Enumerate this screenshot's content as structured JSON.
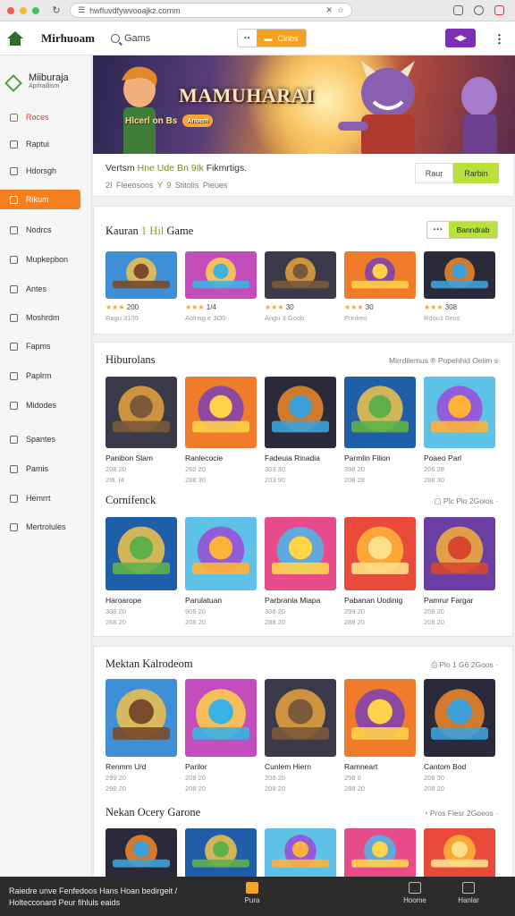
{
  "browser": {
    "url": "hwfluvdfywvooajkz.comm",
    "window_dots": [
      "#f25c54",
      "#f5bd3b",
      "#48c35a"
    ]
  },
  "header": {
    "brand": "Mirhuoam",
    "search_label": "Gams",
    "center_play_label": "Cinbs",
    "promo_label": "◀▶",
    "more_glyph": "··",
    "kebab_glyph": "⋮"
  },
  "sidebar": {
    "brand_name": "Miiburaja",
    "brand_sub": "Aprlraillism",
    "items": [
      {
        "label": "Roces",
        "state": "highlight"
      },
      {
        "label": "Raptui",
        "state": "normal"
      },
      {
        "label": "Hdorsgh",
        "state": "normal"
      },
      {
        "label": "Rikum",
        "state": "active"
      },
      {
        "label": "Nodrcs",
        "state": "normal"
      },
      {
        "label": "Mupkepbon",
        "state": "normal"
      },
      {
        "label": "Antes",
        "state": "normal"
      },
      {
        "label": "Moshrdm",
        "state": "normal"
      },
      {
        "label": "Fapms",
        "state": "normal"
      },
      {
        "label": "Paplrm",
        "state": "normal"
      },
      {
        "label": "Midodes",
        "state": "normal"
      },
      {
        "label": "Spantes",
        "state": "normal"
      },
      {
        "label": "Pamis",
        "state": "normal"
      },
      {
        "label": "Hemrrt",
        "state": "normal"
      },
      {
        "label": "Mertrolules",
        "state": "normal"
      }
    ]
  },
  "hero": {
    "title": "MAMUHARAI",
    "subtitle": "Hlcerl on Bs",
    "button": "Anuem"
  },
  "infobar": {
    "line1_a": "Vertsm",
    "line1_b": "Hne Ude",
    "line1_c": "Bn",
    "line1_d": "9Ik",
    "line1_e": "Fikmrtigs.",
    "line2_a": "2I",
    "line2_b": "Fleeosoos",
    "line2_c": "Y",
    "line2_d": "9",
    "line2_e": "Stitolis",
    "line2_f": "Pieues",
    "btn_ghost": "Raur",
    "btn_primary": "Rarbin"
  },
  "sections": {
    "featured": {
      "title_a": "Kauran",
      "title_b": "1 Hil",
      "title_c": "Game",
      "more": "···",
      "button": "Banndrab",
      "tiles": [
        {
          "stars": "★★★",
          "rating": "200",
          "meta": "Ragu 3100"
        },
        {
          "stars": "★★★",
          "rating": "1/4",
          "meta": "Aolnsg e 3O0"
        },
        {
          "stars": "★★★",
          "rating": "30",
          "meta": "Angu 3 Goob"
        },
        {
          "stars": "★★★",
          "rating": "30",
          "meta": "Pnnkeo"
        },
        {
          "stars": "★★★",
          "rating": "308",
          "meta": "Rdou1 0eos"
        }
      ]
    },
    "hiburolans": {
      "title": "Hiburolans",
      "right": "Mirrdilemus  ®  Popehhid Oelim s",
      "tiles": [
        {
          "name": "Panibon Slam",
          "m1": "208 20",
          "m2": "2I8. I4"
        },
        {
          "name": "Ranlecocie",
          "m1": "260 20",
          "m2": "288 30"
        },
        {
          "name": "Fadeuia Rinadia",
          "m1": "303 30",
          "m2": "203 90"
        },
        {
          "name": "Parmlin Filion",
          "m1": "398 20",
          "m2": "208 28"
        },
        {
          "name": "Poaeo Parl",
          "m1": "206 28",
          "m2": "288 30"
        }
      ]
    },
    "cornifenck": {
      "title": "Cornifenck",
      "right": "▢ Plc Plo 2Goios  ·",
      "tiles": [
        {
          "name": "Haroarope",
          "m1": "308 20",
          "m2": "268 20"
        },
        {
          "name": "Parulatuan",
          "m1": "906 20",
          "m2": "208 20"
        },
        {
          "name": "Parbranla Miapa",
          "m1": "308 20",
          "m2": "288 20"
        },
        {
          "name": "Pabanan Uodinig",
          "m1": "299 20",
          "m2": "288 20"
        },
        {
          "name": "Pamrur Fargar",
          "m1": "208 20",
          "m2": "208 20"
        }
      ]
    },
    "mektan": {
      "title": "Mektan Kalrodeom",
      "right": "⎙ Plo 1 G6 2Goos  ·",
      "tiles": [
        {
          "name": "Renmm U/d",
          "m1": "299 20",
          "m2": "298 20"
        },
        {
          "name": "Parilor",
          "m1": "208 20",
          "m2": "208 20"
        },
        {
          "name": "Cunlem Hiern",
          "m1": "208 20",
          "m2": "208 20"
        },
        {
          "name": "Ramneart",
          "m1": "298 0",
          "m2": "288 20"
        },
        {
          "name": "Cantom Bod",
          "m1": "208 30",
          "m2": "208 20"
        }
      ]
    },
    "nekan": {
      "title": "Nekan Ocery Garone",
      "right": "◔ Pros Flesr 2Goeos  ·"
    }
  },
  "bottombar": {
    "line1": "Raiedre unve Fenfedoos Hans Hoan bedirgeit /",
    "line2": "Holtecconard Peur fihluls eaids",
    "tabs": [
      "Pura",
      "Hoome",
      "Hanlar"
    ]
  }
}
